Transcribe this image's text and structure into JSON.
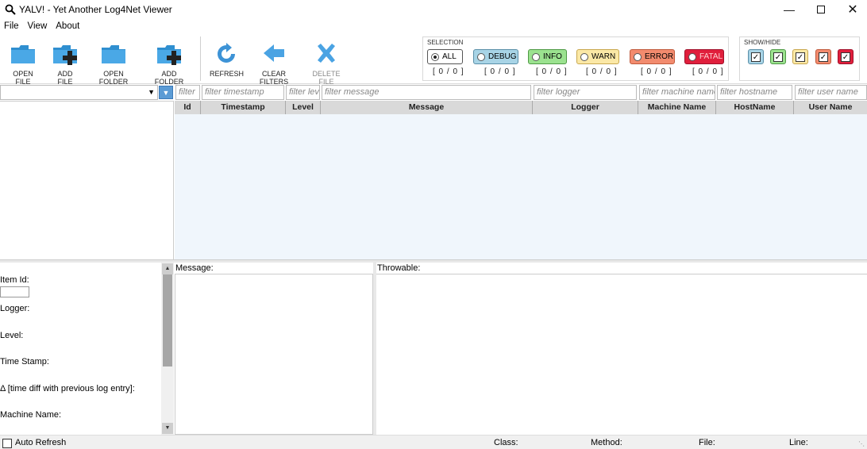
{
  "window": {
    "title": "YALV! - Yet Another Log4Net Viewer",
    "controls": [
      "minimize",
      "maximize",
      "close"
    ]
  },
  "menu": [
    "File",
    "View",
    "About"
  ],
  "toolbar": {
    "open_file": "OPEN FILE",
    "add_file": "ADD FILE",
    "open_folder": "OPEN FOLDER",
    "add_folder": "ADD FOLDER",
    "refresh": "REFRESH",
    "clear_filters": "CLEAR FILTERS",
    "delete_file": "DELETE FILE"
  },
  "selection": {
    "title": "SELECTION",
    "levels": [
      {
        "label": "ALL",
        "count": "[ 0 / 0 ]",
        "bg": "#ffffff",
        "border": "#555555",
        "selected": true
      },
      {
        "label": "DEBUG",
        "count": "[ 0 / 0 ]",
        "bg": "#a8d4e6",
        "border": "#5a8fa8",
        "selected": false
      },
      {
        "label": "INFO",
        "count": "[ 0 / 0 ]",
        "bg": "#9be28f",
        "border": "#4f9a45",
        "selected": false
      },
      {
        "label": "WARN",
        "count": "[ 0 / 0 ]",
        "bg": "#fbe8a6",
        "border": "#c8a84e",
        "selected": false
      },
      {
        "label": "ERROR",
        "count": "[ 0 / 0 ]",
        "bg": "#f28b6e",
        "border": "#c05a3c",
        "selected": false
      },
      {
        "label": "FATAL",
        "count": "[ 0 / 0 ]",
        "bg": "#e01f3c",
        "border": "#a0102a",
        "selected": false
      }
    ]
  },
  "showhide": {
    "title": "SHOW/HIDE",
    "toggles": [
      {
        "level": "debug",
        "bg": "#a8d4e6"
      },
      {
        "level": "info",
        "bg": "#9be28f"
      },
      {
        "level": "warn",
        "bg": "#fbe8a6"
      },
      {
        "level": "error",
        "bg": "#f28b6e"
      },
      {
        "level": "fatal",
        "bg": "#e01f3c"
      }
    ]
  },
  "filters": {
    "id": "filter",
    "timestamp": "filter timestamp",
    "level": "filter level",
    "message": "filter message",
    "logger": "filter logger",
    "machine": "filter machine name",
    "hostname": "filter hostname",
    "username": "filter user name"
  },
  "columns": [
    "Id",
    "Timestamp",
    "Level",
    "Message",
    "Logger",
    "Machine Name",
    "HostName",
    "User Name"
  ],
  "details": {
    "item_id": "Item Id:",
    "logger": "Logger:",
    "level": "Level:",
    "timestamp": "Time Stamp:",
    "delta": "Δ [time diff with previous log entry]:",
    "machine": "Machine Name:"
  },
  "panes": {
    "message": "Message:",
    "throwable": "Throwable:"
  },
  "status": {
    "auto_refresh": "Auto Refresh",
    "class": "Class:",
    "method": "Method:",
    "file": "File:",
    "line": "Line:"
  },
  "colors": {
    "grid_bg": "#f0f6fc",
    "header_bg": "#d9d9d9",
    "accent": "#5b9bd5"
  }
}
